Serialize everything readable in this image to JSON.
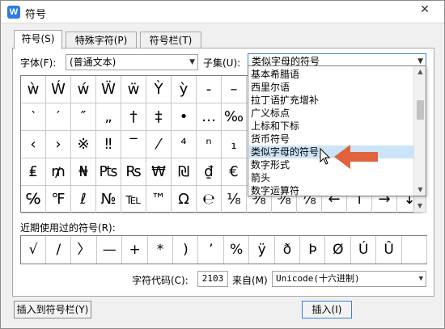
{
  "window": {
    "title": "符号",
    "close_glyph": "✕",
    "app_icon_letter": "W"
  },
  "tabs": [
    {
      "label": "符号(S)"
    },
    {
      "label": "特殊字符(P)"
    },
    {
      "label": "符号栏(T)"
    }
  ],
  "font": {
    "label": "字体(F):",
    "value": "(普通文本)"
  },
  "subset": {
    "label": "子集(U):",
    "value": "类似字母的符号"
  },
  "subset_options": [
    "基本希腊语",
    "西里尔语",
    "拉丁语扩充增补",
    "广义标点",
    "上标和下标",
    "货币符号",
    "类似字母的符号",
    "数字形式",
    "箭头",
    "数字运算符"
  ],
  "subset_selected_index": 6,
  "symbol_grid": [
    [
      "ẁ",
      "Ẃ",
      "ẃ",
      "Ẅ",
      "ẅ",
      "Ỳ",
      "ỳ",
      "‐",
      "–",
      "",
      "",
      "",
      "",
      "",
      "",
      ""
    ],
    [
      "‵",
      "′",
      "″",
      "„",
      "†",
      "‡",
      "•",
      "…",
      "‰",
      "",
      "",
      "",
      "",
      "",
      "",
      ""
    ],
    [
      "‹",
      "›",
      "※",
      "‼",
      "‾",
      "⁄",
      "⁴",
      "ⁿ",
      "₁",
      "",
      "",
      "",
      "",
      "",
      "",
      ""
    ],
    [
      "₤",
      "₥",
      "₦",
      "₧",
      "₨",
      "₩",
      "₪",
      "₫",
      "€",
      "",
      "",
      "",
      "",
      "",
      "",
      ""
    ],
    [
      "℅",
      "℉",
      "ℓ",
      "№",
      "℡",
      "™",
      "Ω",
      "℮",
      "⅛",
      "⅜",
      "⅝",
      "⅞",
      "←",
      "↑",
      "→",
      "↓"
    ]
  ],
  "recent": {
    "label": "近期使用过的符号(R):",
    "symbols": [
      "√",
      "/",
      "〉",
      "—",
      "+",
      "*",
      ")",
      "’",
      "%",
      "ÿ",
      "ð",
      "Þ",
      "Ø",
      "Ú",
      "Û",
      ""
    ]
  },
  "char_code": {
    "label": "字符代码(C):",
    "value": "2103"
  },
  "from": {
    "label": "来自(M)",
    "value": "Unicode(十六进制)"
  },
  "buttons": {
    "insert_to_bar": "插入到符号栏(Y)",
    "insert": "插入(I)"
  },
  "colors": {
    "accent": "#2e7be6",
    "selection": "#cce4f7",
    "annotation_arrow": "#e0633d"
  }
}
